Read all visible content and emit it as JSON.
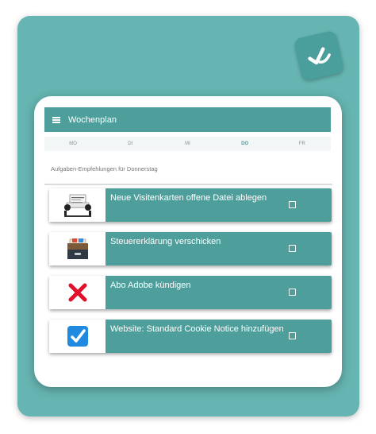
{
  "app": {
    "title": "Wochenplan"
  },
  "days": [
    {
      "label": "MO",
      "active": false
    },
    {
      "label": "DI",
      "active": false
    },
    {
      "label": "MI",
      "active": false
    },
    {
      "label": "DO",
      "active": true
    },
    {
      "label": "FR",
      "active": false
    }
  ],
  "section": {
    "heading": "Aufgaben-Empfehlungen für Donnerstag"
  },
  "tasks": [
    {
      "label": "Neue Visitenkarten offene Datei ablegen",
      "icon": "card-holder-icon",
      "checked": false
    },
    {
      "label": "Steuererklärung verschicken",
      "icon": "file-cabinet-icon",
      "checked": false
    },
    {
      "label": "Abo Adobe kündigen",
      "icon": "cross-mark-icon",
      "checked": false
    },
    {
      "label": "Website: Standard Cookie Notice hinzufügen",
      "icon": "check-box-icon",
      "checked": false
    }
  ],
  "colors": {
    "accent": "#4e9f9c",
    "background": "#66b5b2",
    "logo": "#4a9e9b",
    "cross": "#e0102a",
    "checkbox": "#1f8ae0"
  }
}
